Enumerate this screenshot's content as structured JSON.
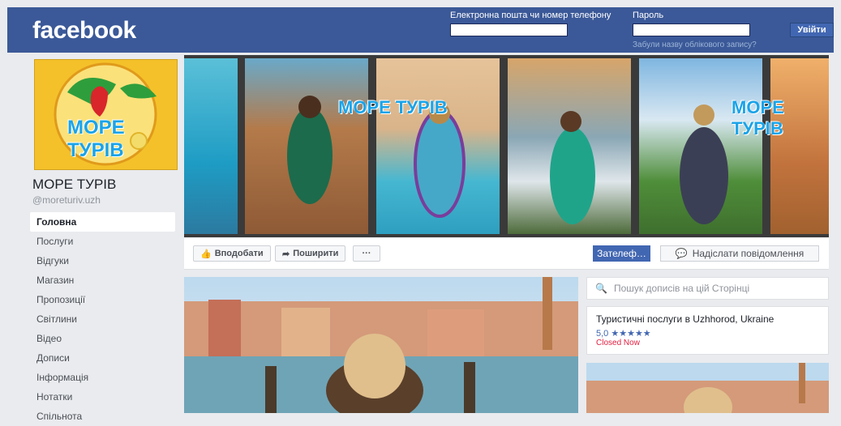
{
  "topbar": {
    "logo": "facebook",
    "email_label": "Електронна пошта чи номер телефону",
    "password_label": "Пароль",
    "login_button": "Увійти",
    "forgot_link": "Забули назву облікового запису?",
    "email_value": "",
    "password_value": ""
  },
  "page": {
    "avatar_logo": "МОРЕ ТУРІВ",
    "name": "МОРЕ ТУРІВ",
    "handle": "@moreturiv.uzh"
  },
  "nav": {
    "items": [
      {
        "label": "Головна",
        "active": true
      },
      {
        "label": "Послуги"
      },
      {
        "label": "Відгуки"
      },
      {
        "label": "Магазин"
      },
      {
        "label": "Пропозиції"
      },
      {
        "label": "Світлини"
      },
      {
        "label": "Відео"
      },
      {
        "label": "Дописи"
      },
      {
        "label": "Інформація"
      },
      {
        "label": "Нотатки"
      },
      {
        "label": "Спільнота"
      }
    ]
  },
  "actions": {
    "like": "Вподобати",
    "share": "Поширити",
    "more": "···",
    "call": "Зателеф…",
    "message": "Надіслати повідомлення"
  },
  "sidebar": {
    "search_placeholder": "Пошук дописів на цій Сторінці",
    "info_title": "Туристичні послуги в Uzhhorod, Ukraine",
    "rating": "5,0",
    "stars": "★★★★★",
    "status": "Closed Now"
  },
  "colors": {
    "brand": "#3b5998",
    "button": "#4267b2",
    "closed": "#e41e3f"
  }
}
